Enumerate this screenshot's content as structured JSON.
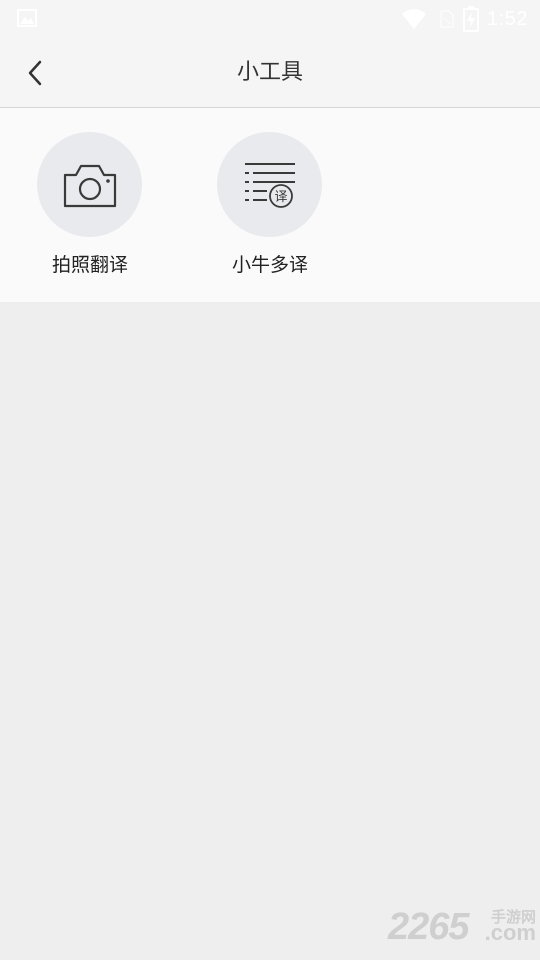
{
  "status_bar": {
    "time": "1:52",
    "icons": [
      "image-notification-icon",
      "wifi-icon",
      "sim-card-icon",
      "battery-charging-icon"
    ]
  },
  "header": {
    "title": "小工具",
    "back_icon": "chevron-left-icon"
  },
  "tools": [
    {
      "label": "拍照翻译",
      "icon": "camera-icon"
    },
    {
      "label": "小牛多译",
      "icon": "document-translate-icon",
      "icon_badge": "译"
    }
  ],
  "watermark": {
    "number": "2265",
    "cn": "手游网",
    "domain": ".com"
  },
  "colors": {
    "background": "#eeeeee",
    "bar": "#f5f5f5",
    "panel": "#fafafa",
    "icon_circle": "#e8eaed",
    "icon_stroke": "#3a3a3a",
    "text": "#222222"
  }
}
